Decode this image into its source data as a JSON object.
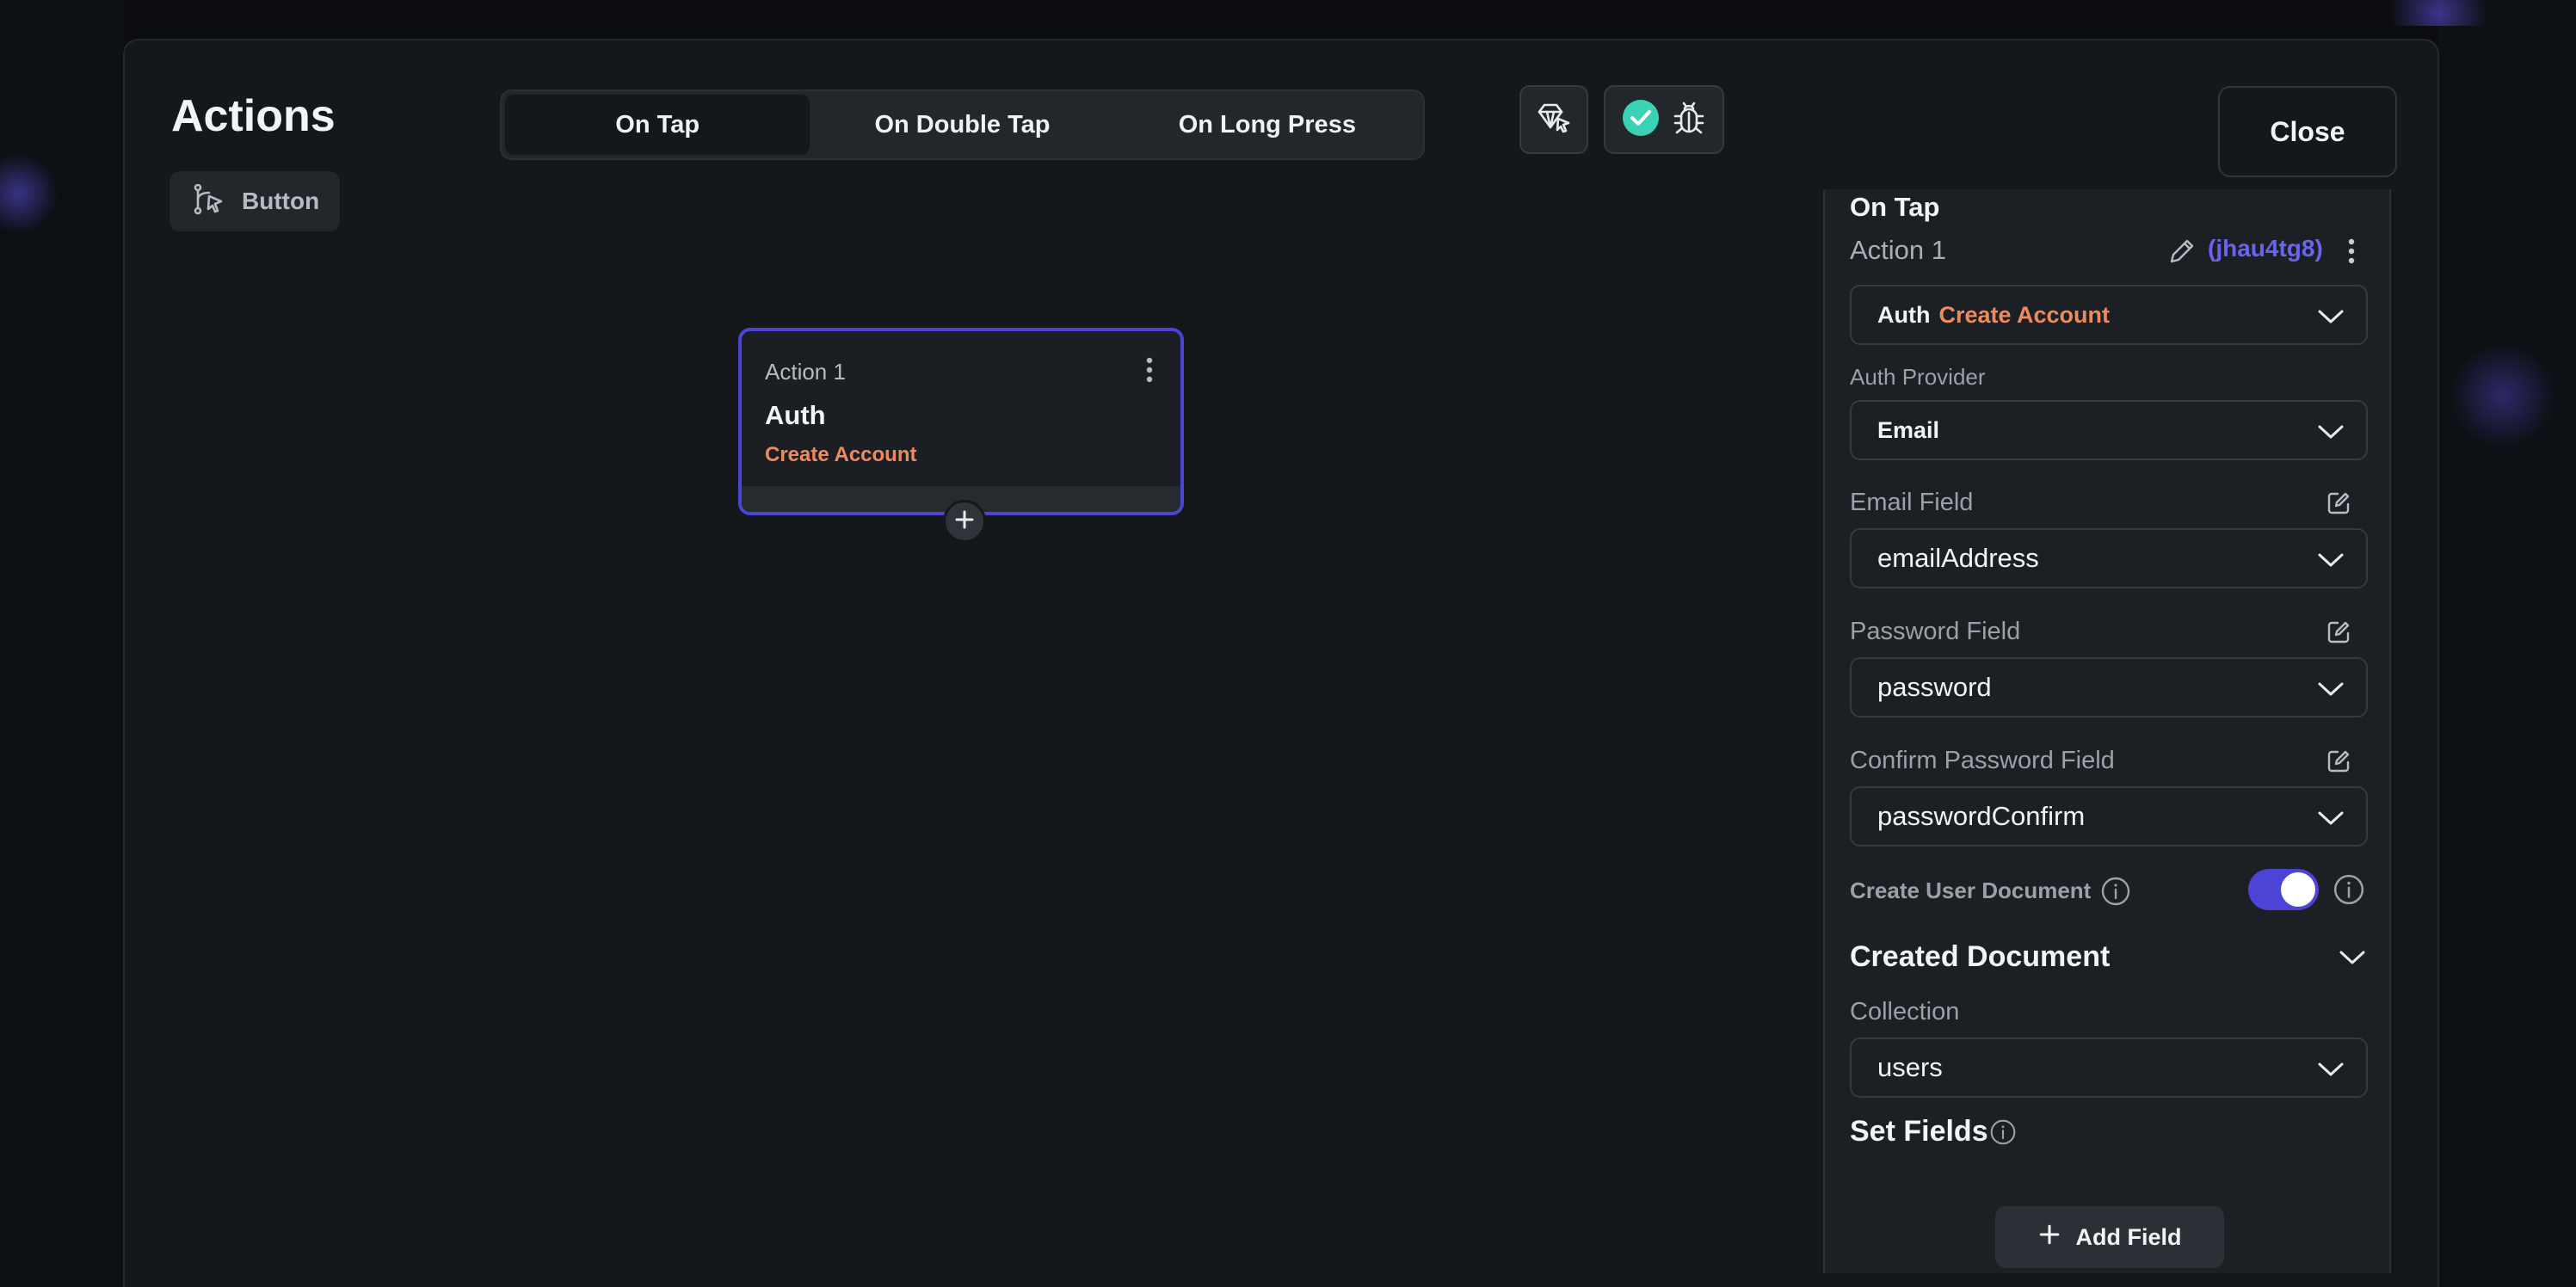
{
  "header": {
    "title": "Actions",
    "widget_chip": {
      "label": "Button",
      "icon": "branch-cursor-icon"
    }
  },
  "tabs": [
    {
      "label": "On Tap",
      "active": true
    },
    {
      "label": "On Double Tap",
      "active": false
    },
    {
      "label": "On Long Press",
      "active": false
    }
  ],
  "toolbar": {
    "ai_icon": "gem-cursor-icon",
    "status_icon": "check-circle-icon",
    "debug_icon": "bug-icon",
    "status_color": "#39d2b4",
    "close_label": "Close"
  },
  "canvas": {
    "node": {
      "action_label": "Action 1",
      "type": "Auth",
      "subtype": "Create Account"
    }
  },
  "panel": {
    "trigger_title": "On Tap",
    "action_label": "Action 1",
    "action_id": "(jhau4tg8)",
    "action_select": {
      "type": "Auth",
      "subtype": "Create Account"
    },
    "auth_provider": {
      "label": "Auth Provider",
      "value": "Email"
    },
    "email_field": {
      "label": "Email Field",
      "value": "emailAddress"
    },
    "password_field": {
      "label": "Password Field",
      "value": "password"
    },
    "confirm_password_field": {
      "label": "Confirm Password Field",
      "value": "passwordConfirm"
    },
    "create_user_document": {
      "label": "Create User Document",
      "enabled": true
    },
    "created_document": {
      "title": "Created Document",
      "collection_label": "Collection",
      "collection_value": "users"
    },
    "set_fields": {
      "title": "Set Fields",
      "add_label": "Add Field"
    }
  },
  "colors": {
    "accent": "#4b44d6",
    "id_link": "#6b63f2",
    "subtype_orange": "#f08a5d"
  }
}
